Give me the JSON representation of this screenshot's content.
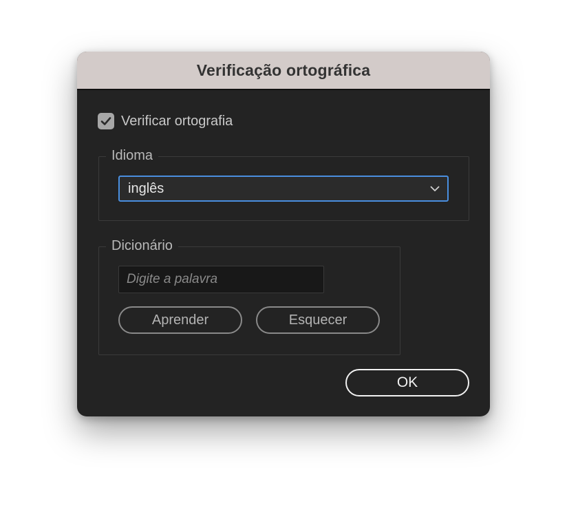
{
  "dialog": {
    "title": "Verificação ortográfica"
  },
  "spellcheck": {
    "label": "Verificar ortografia",
    "checked": true
  },
  "language": {
    "legend": "Idioma",
    "selected": "inglês",
    "icon": "chevron-down-icon"
  },
  "dictionary": {
    "legend": "Dicionário",
    "input_value": "",
    "input_placeholder": "Digite a palavra",
    "learn_label": "Aprender",
    "forget_label": "Esquecer"
  },
  "footer": {
    "ok_label": "OK"
  },
  "colors": {
    "dialog_bg": "#232323",
    "titlebar_bg": "#d3cbc9",
    "focus_accent": "#4a8fe0",
    "checkbox_bg": "#a7a7a7"
  }
}
